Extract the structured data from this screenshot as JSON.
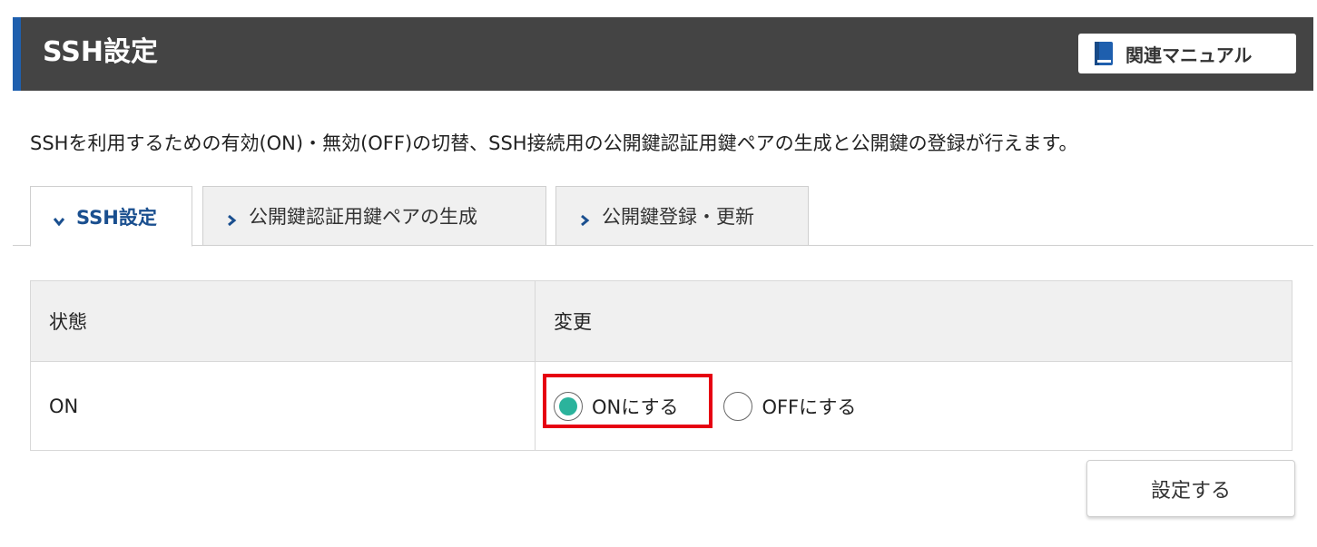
{
  "header": {
    "title": "SSH設定",
    "manual_button": {
      "label": "関連マニュアル",
      "icon": "book-icon"
    }
  },
  "description": "SSHを利用するための有効(ON)・無効(OFF)の切替、SSH接続用の公開鍵認証用鍵ペアの生成と公開鍵の登録が行えます。",
  "tabs": [
    {
      "label": "SSH設定",
      "active": true
    },
    {
      "label": "公開鍵認証用鍵ペアの生成",
      "active": false
    },
    {
      "label": "公開鍵登録・更新",
      "active": false
    }
  ],
  "table": {
    "headers": [
      "状態",
      "変更"
    ],
    "status_value": "ON",
    "options": [
      {
        "label": "ONにする",
        "selected": true
      },
      {
        "label": "OFFにする",
        "selected": false
      }
    ]
  },
  "submit_button": {
    "label": "設定する"
  },
  "colors": {
    "header_bg": "#444444",
    "header_accent": "#1e5fae",
    "radio_selected": "#2bb39c",
    "highlight": "#e60012",
    "active_tab_text": "#1a4f8f"
  }
}
